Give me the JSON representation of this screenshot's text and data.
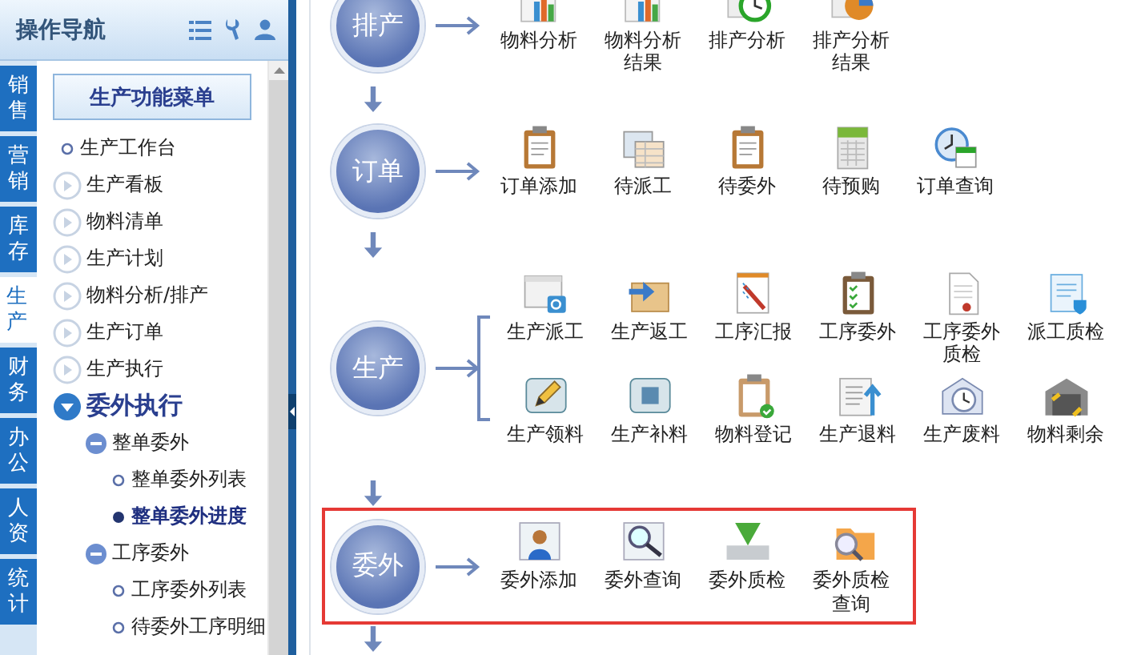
{
  "header": {
    "title": "操作导航"
  },
  "tabs": [
    {
      "label": "销售",
      "selected": false
    },
    {
      "label": "营销",
      "selected": false
    },
    {
      "label": "库存",
      "selected": false
    },
    {
      "label": "生产",
      "selected": true
    },
    {
      "label": "财务",
      "selected": false
    },
    {
      "label": "办公",
      "selected": false
    },
    {
      "label": "人资",
      "selected": false
    },
    {
      "label": "统计",
      "selected": false
    }
  ],
  "menu_button": "生产功能菜单",
  "tree": [
    {
      "label": "生产工作台",
      "kind": "leaf",
      "selected": false
    },
    {
      "label": "生产看板",
      "kind": "group",
      "expanded": false
    },
    {
      "label": "物料清单",
      "kind": "group",
      "expanded": false
    },
    {
      "label": "生产计划",
      "kind": "group",
      "expanded": false
    },
    {
      "label": "物料分析/排产",
      "kind": "group",
      "expanded": false
    },
    {
      "label": "生产订单",
      "kind": "group",
      "expanded": false
    },
    {
      "label": "生产执行",
      "kind": "group",
      "expanded": false
    },
    {
      "label": "委外执行",
      "kind": "group",
      "expanded": true,
      "children": [
        {
          "label": "整单委外",
          "kind": "group",
          "expanded": true,
          "children": [
            {
              "label": "整单委外列表",
              "kind": "leaf",
              "selected": false
            },
            {
              "label": "整单委外进度",
              "kind": "leaf",
              "selected": true
            }
          ]
        },
        {
          "label": "工序委外",
          "kind": "group",
          "expanded": true,
          "children": [
            {
              "label": "工序委外列表",
              "kind": "leaf",
              "selected": false
            },
            {
              "label": "待委外工序明细",
              "kind": "leaf",
              "selected": false
            }
          ]
        }
      ]
    }
  ],
  "stages": [
    {
      "label": "排产",
      "highlighted": false,
      "rows": [
        [
          "物料分析",
          "物料分析结果",
          "排产分析",
          "排产分析结果"
        ]
      ]
    },
    {
      "label": "订单",
      "highlighted": false,
      "rows": [
        [
          "订单添加",
          "待派工",
          "待委外",
          "待预购",
          "订单查询"
        ]
      ]
    },
    {
      "label": "生产",
      "highlighted": false,
      "rows": [
        [
          "生产派工",
          "生产返工",
          "工序汇报",
          "工序委外",
          "工序委外质检",
          "派工质检"
        ],
        [
          "生产领料",
          "生产补料",
          "物料登记",
          "生产退料",
          "生产废料",
          "物料剩余"
        ]
      ]
    },
    {
      "label": "委外",
      "highlighted": true,
      "rows": [
        [
          "委外添加",
          "委外查询",
          "委外质检",
          "委外质检查询"
        ]
      ]
    }
  ]
}
